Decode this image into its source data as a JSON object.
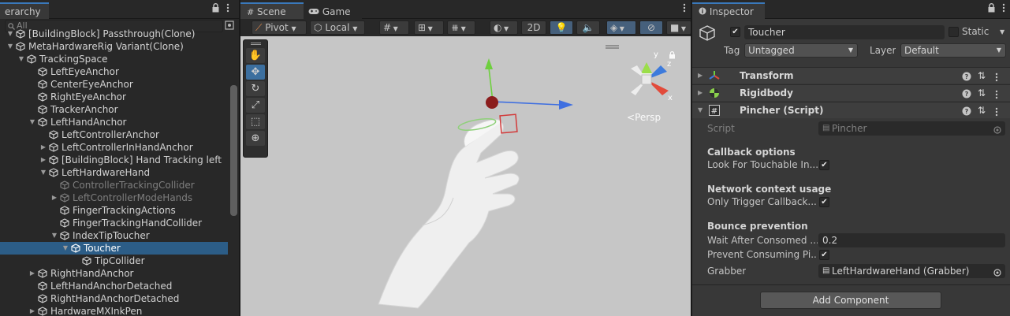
{
  "hierarchy": {
    "tab_label": "erarchy",
    "search_placeholder": "All",
    "items": [
      {
        "label": "[BuildingBlock] Passthrough(Clone)",
        "depth": 0,
        "expand": "open"
      },
      {
        "label": "MetaHardwareRig Variant(Clone)",
        "depth": 0,
        "expand": "open"
      },
      {
        "label": "TrackingSpace",
        "depth": 1,
        "expand": "open"
      },
      {
        "label": "LeftEyeAnchor",
        "depth": 2,
        "expand": "none"
      },
      {
        "label": "CenterEyeAnchor",
        "depth": 2,
        "expand": "none"
      },
      {
        "label": "RightEyeAnchor",
        "depth": 2,
        "expand": "none"
      },
      {
        "label": "TrackerAnchor",
        "depth": 2,
        "expand": "none"
      },
      {
        "label": "LeftHandAnchor",
        "depth": 2,
        "expand": "open"
      },
      {
        "label": "LeftControllerAnchor",
        "depth": 3,
        "expand": "none"
      },
      {
        "label": "LeftControllerInHandAnchor",
        "depth": 3,
        "expand": "closed"
      },
      {
        "label": "[BuildingBlock] Hand Tracking left",
        "depth": 3,
        "expand": "closed"
      },
      {
        "label": "LeftHardwareHand",
        "depth": 3,
        "expand": "open"
      },
      {
        "label": "ControllerTrackingCollider",
        "depth": 4,
        "expand": "none",
        "dim": true
      },
      {
        "label": "LeftControllerModeHands",
        "depth": 4,
        "expand": "closed",
        "dim": true
      },
      {
        "label": "FingerTrackingActions",
        "depth": 4,
        "expand": "none"
      },
      {
        "label": "FingerTrackingHandCollider",
        "depth": 4,
        "expand": "none"
      },
      {
        "label": "IndexTipToucher",
        "depth": 4,
        "expand": "open"
      },
      {
        "label": "Toucher",
        "depth": 5,
        "expand": "open",
        "selected": true
      },
      {
        "label": "TipCollider",
        "depth": 6,
        "expand": "none"
      },
      {
        "label": "RightHandAnchor",
        "depth": 2,
        "expand": "closed"
      },
      {
        "label": "LeftHandAnchorDetached",
        "depth": 2,
        "expand": "none"
      },
      {
        "label": "RightHandAnchorDetached",
        "depth": 2,
        "expand": "none"
      },
      {
        "label": "HardwareMXInkPen",
        "depth": 2,
        "expand": "closed"
      }
    ]
  },
  "scene": {
    "tabs": [
      "Scene",
      "Game"
    ],
    "toolbar": {
      "pivot": "Pivot",
      "space": "Local",
      "two_d": "2D"
    },
    "persp_label": "Persp",
    "gizmo_axes": [
      "y",
      "z",
      "x"
    ]
  },
  "inspector": {
    "tab_label": "Inspector",
    "object_name": "Toucher",
    "static_label": "Static",
    "tag_label": "Tag",
    "tag_value": "Untagged",
    "layer_label": "Layer",
    "layer_value": "Default",
    "components": {
      "transform": "Transform",
      "rigidbody": "Rigidbody",
      "pincher": "Pincher (Script)"
    },
    "script_label": "Script",
    "script_value": "Pincher",
    "sections": {
      "callback": "Callback options",
      "network": "Network context usage",
      "bounce": "Bounce prevention"
    },
    "fields": {
      "look_for_touchable": "Look For Touchable In...",
      "only_trigger": "Only Trigger Callback...",
      "wait_after_consumed": "Wait After Consomed ...",
      "wait_value": "0.2",
      "prevent_consuming": "Prevent Consuming Pi...",
      "grabber_label": "Grabber",
      "grabber_value": "LeftHardwareHand (Grabber)"
    },
    "add_component": "Add Component"
  }
}
